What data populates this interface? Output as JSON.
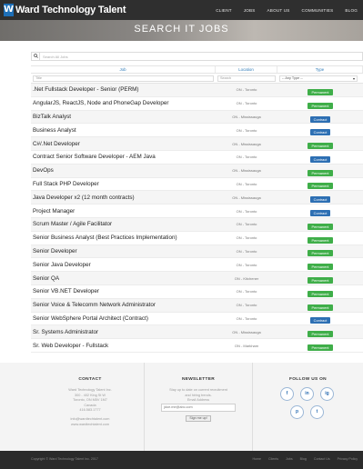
{
  "header": {
    "logo_mark": "W",
    "logo_text": "Ward Technology Talent",
    "nav": [
      "CLIENT",
      "JOBS",
      "ABOUT US",
      "COMMUNITIES",
      "BLOG"
    ]
  },
  "hero": {
    "title": "SEARCH IT JOBS"
  },
  "search": {
    "placeholder": "Search All Jobs"
  },
  "table": {
    "headers": {
      "job": "Job",
      "location": "Location",
      "type": "Type"
    },
    "filters": {
      "title_placeholder": "Title",
      "search_placeholder": "Search",
      "type_selected": "-- Any Type --"
    },
    "rows": [
      {
        "title": ".Net Fullstack Developer - Senior (PERM)",
        "location": "ON - Toronto",
        "type": "Permanent"
      },
      {
        "title": "AngularJS, ReactJS, Node and PhoneGap Developer",
        "location": "ON - Toronto",
        "type": "Permanent"
      },
      {
        "title": "BizTalk Analyst",
        "location": "ON - Mississauga",
        "type": "Contract"
      },
      {
        "title": "Business Analyst",
        "location": "ON - Toronto",
        "type": "Contract"
      },
      {
        "title": "C#/.Net Developer",
        "location": "ON - Mississauga",
        "type": "Permanent"
      },
      {
        "title": "Contract Senior Software Developer - AEM Java",
        "location": "ON - Toronto",
        "type": "Contract"
      },
      {
        "title": "DevOps",
        "location": "ON - Mississauga",
        "type": "Permanent"
      },
      {
        "title": "Full Stack PHP Developer",
        "location": "ON - Toronto",
        "type": "Permanent"
      },
      {
        "title": "Java Developer x2 (12 month contracts)",
        "location": "ON - Mississauga",
        "type": "Contract"
      },
      {
        "title": "Project Manager",
        "location": "ON - Toronto",
        "type": "Contract"
      },
      {
        "title": "Scrum Master / Agile Facilitator",
        "location": "ON - Toronto",
        "type": "Permanent"
      },
      {
        "title": "Senior Business Analyst (Best Practices Implementation)",
        "location": "ON - Toronto",
        "type": "Permanent"
      },
      {
        "title": "Senior Developer",
        "location": "ON - Toronto",
        "type": "Permanent"
      },
      {
        "title": "Senior Java Developer",
        "location": "ON - Toronto",
        "type": "Permanent"
      },
      {
        "title": "Senior QA",
        "location": "ON - Kitchener",
        "type": "Permanent"
      },
      {
        "title": "Senior VB.NET Developer",
        "location": "ON - Toronto",
        "type": "Permanent"
      },
      {
        "title": "Senior Voice & Telecomm Network Administrator",
        "location": "ON - Toronto",
        "type": "Permanent"
      },
      {
        "title": "Senior WebSphere Portal Architect (Contract)",
        "location": "ON - Toronto",
        "type": "Contract"
      },
      {
        "title": "Sr. Systems Administrator",
        "location": "ON - Mississauga",
        "type": "Permanent"
      },
      {
        "title": "Sr. Web Developer - Fullstack",
        "location": "ON - Markham",
        "type": "Permanent"
      }
    ]
  },
  "footer": {
    "contact": {
      "heading": "CONTACT",
      "lines": [
        "Ward Technology Talent Inc.",
        "300 - 402 King St W",
        "Toronto, ON M5V 1M7",
        "Canada",
        "416.583.1777",
        "",
        "info@wardtechtalent.com",
        "www.wardtechtalent.com"
      ]
    },
    "newsletter": {
      "heading": "NEWSLETTER",
      "lines": [
        "Stay up to date on current recruitment",
        "and hiring trends."
      ],
      "email_label": "Email Address",
      "email_value": "jdoe.me@abc.com",
      "button": "Sign me up!"
    },
    "follow": {
      "heading": "FOLLOW US ON",
      "icons": [
        "f",
        "in",
        "ig",
        "p",
        "t"
      ]
    }
  },
  "bottom": {
    "copyright": "Copyright © Ward Technology Talent Inc. 2017",
    "links": [
      "Home",
      "Clients",
      "Jobs",
      "Blog",
      "Contact Us",
      "Privacy Policy"
    ]
  },
  "colors": {
    "permanent": "#3fae49",
    "contract": "#2d6fb3",
    "header_bg": "#2f2f2f"
  }
}
